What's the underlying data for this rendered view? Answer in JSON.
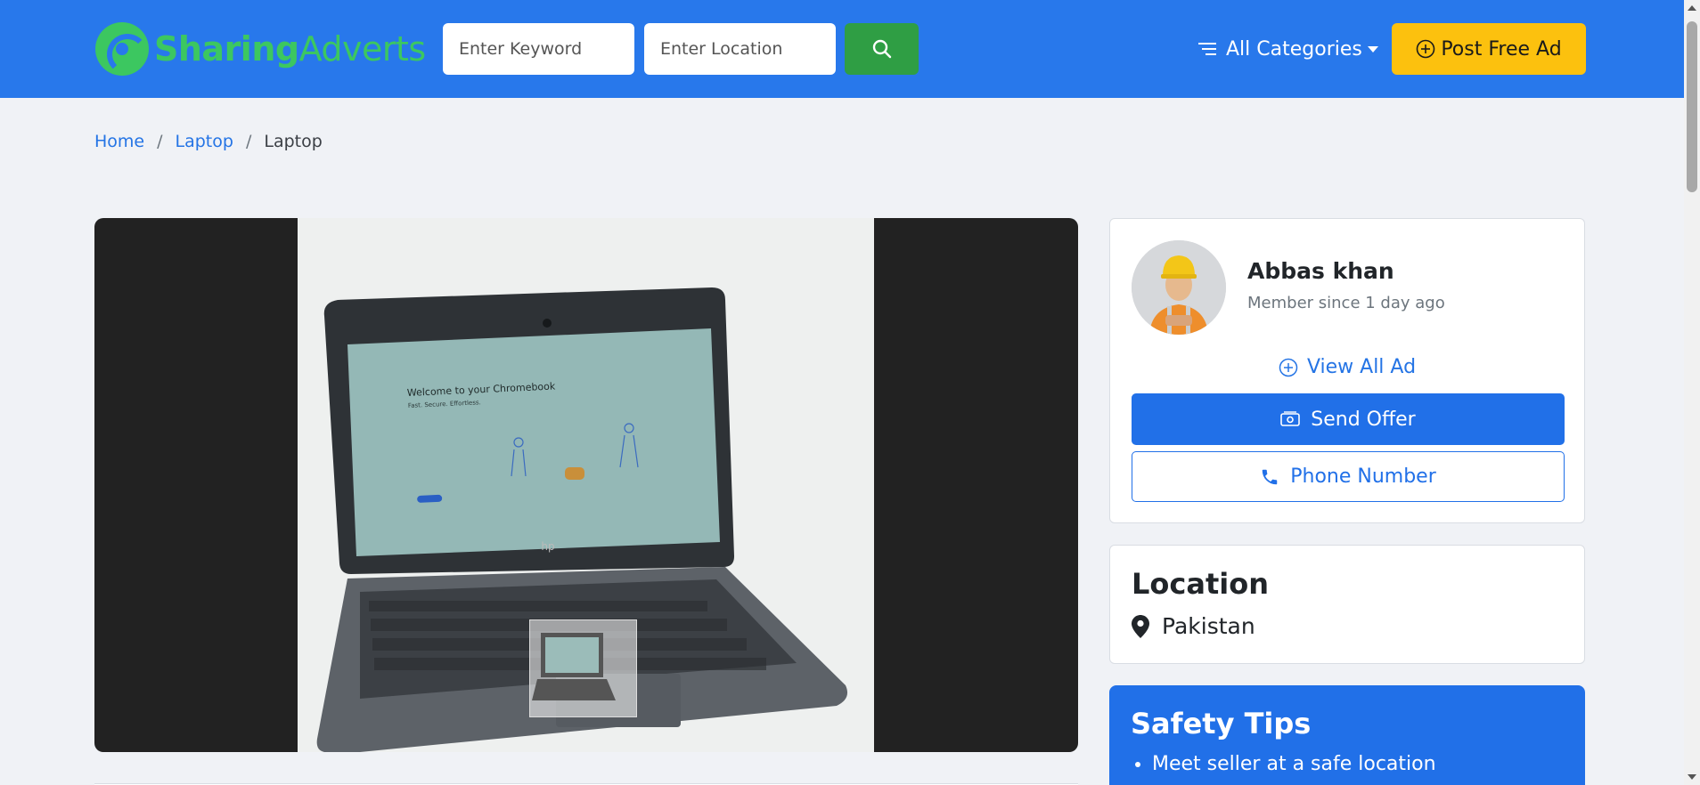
{
  "header": {
    "logo_part1": "Sharing",
    "logo_part2": "Adverts",
    "keyword_placeholder": "Enter Keyword",
    "location_placeholder": "Enter Location",
    "categories_label": "All Categories",
    "post_ad_label": "Post Free Ad",
    "brand_color": "#2878eb",
    "logo_color": "#3cc760",
    "search_button_color": "#2f9e44",
    "post_button_color": "#fcc10e"
  },
  "breadcrumb": {
    "items": [
      "Home",
      "Laptop"
    ],
    "current": "Laptop"
  },
  "seller": {
    "name": "Abbas khan",
    "member_since": "Member since 1 day ago",
    "view_all_label": "View All Ad",
    "send_offer_label": "Send Offer",
    "phone_label": "Phone Number"
  },
  "location": {
    "title": "Location",
    "value": "Pakistan"
  },
  "safety": {
    "title": "Safety Tips",
    "tips": [
      "Meet seller at a safe location"
    ]
  },
  "laptop_screen_text": {
    "title": "Welcome to your Chromebook",
    "subtitle": "Fast. Secure. Effortless."
  },
  "icons": {
    "search": "search-icon",
    "menu": "menu-lines-icon",
    "plus": "plus-circle-icon",
    "camera": "money-icon",
    "phone": "phone-icon",
    "pin": "map-pin-icon"
  }
}
